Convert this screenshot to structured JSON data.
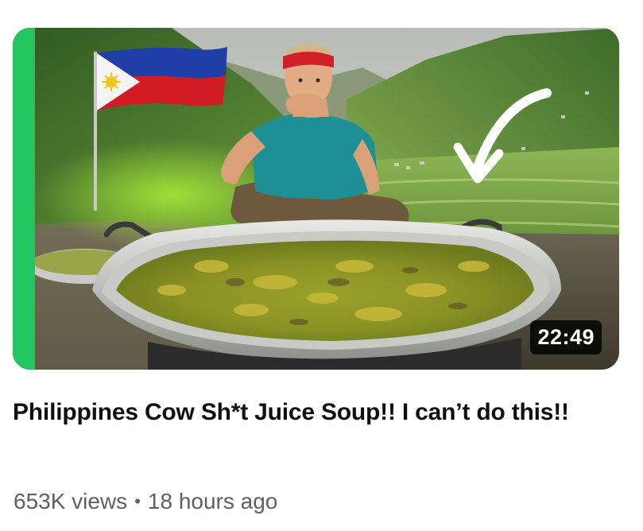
{
  "video": {
    "duration": "22:49",
    "title": "Philippines Cow Sh*t Juice Soup!! I can’t do this!!",
    "views": "653K views",
    "separator": "•",
    "age": "18 hours ago"
  },
  "thumbnail_icons": {
    "flag": "philippines-flag",
    "arrow": "white-curved-arrow"
  },
  "colors": {
    "title": "#0f0f0f",
    "meta": "#606060",
    "accent_stripe": "#22c55e",
    "duration_bg": "#000000"
  }
}
